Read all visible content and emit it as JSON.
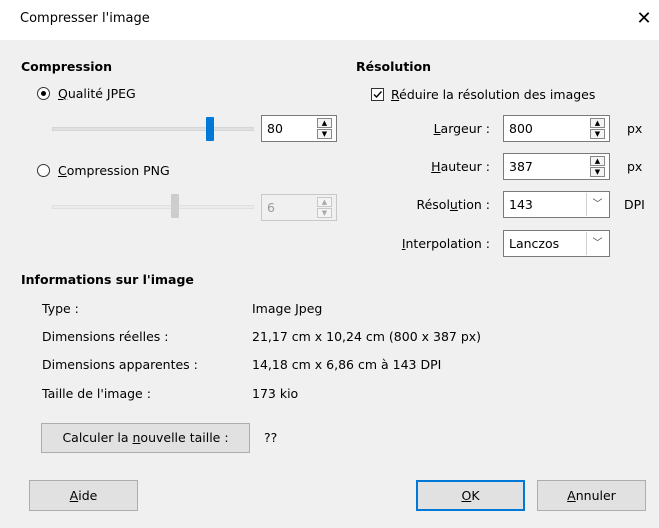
{
  "window": {
    "title": "Compresser l'image",
    "close_glyph": "✕"
  },
  "compression": {
    "heading": "Compression",
    "jpeg": {
      "label_mnemonic": "Q",
      "label_rest": "ualité JPEG",
      "selected": true,
      "value": "80",
      "slider_fraction": 0.8
    },
    "png": {
      "label_mnemonic": "C",
      "label_rest": "ompression PNG",
      "selected": false,
      "value": "6",
      "slider_fraction": 0.66
    }
  },
  "resolution": {
    "heading": "Résolution",
    "reduce": {
      "label_mnemonic": "R",
      "label_rest": "éduire la résolution des images",
      "checked": true
    },
    "width": {
      "label_pre": "",
      "label_mnemonic": "L",
      "label_post": "argeur :",
      "value": "800",
      "unit": "px"
    },
    "height": {
      "label_pre": "",
      "label_mnemonic": "H",
      "label_post": "auteur :",
      "value": "387",
      "unit": "px"
    },
    "dpi": {
      "label_pre": "Résol",
      "label_mnemonic": "u",
      "label_post": "tion :",
      "value": "143",
      "unit": "DPI"
    },
    "interpolation": {
      "label_pre": "",
      "label_mnemonic": "I",
      "label_post": "nterpolation :",
      "value": "Lanczos"
    }
  },
  "info": {
    "heading": "Informations sur l'image",
    "rows": [
      {
        "label": "Type :",
        "value": "Image Jpeg"
      },
      {
        "label": "Dimensions réelles :",
        "value": "21,17 cm x 10,24 cm (800 x 387 px)"
      },
      {
        "label": "Dimensions apparentes :",
        "value": "14,18 cm x 6,86 cm à 143 DPI"
      },
      {
        "label": "Taille de l'image :",
        "value": "173 kio"
      }
    ],
    "calc_button": {
      "pre": "Calculer la ",
      "mnemonic": "n",
      "post": "ouvelle taille :"
    },
    "new_size": "??"
  },
  "buttons": {
    "help": {
      "mnemonic": "A",
      "rest": "ide"
    },
    "ok": {
      "mnemonic": "O",
      "rest": "K"
    },
    "cancel": {
      "mnemonic": "A",
      "rest": "nnuler"
    }
  },
  "colors": {
    "accent": "#0078d7",
    "disabled_thumb": "#cdcdcd",
    "dialog_bg": "#f0f0f0"
  }
}
